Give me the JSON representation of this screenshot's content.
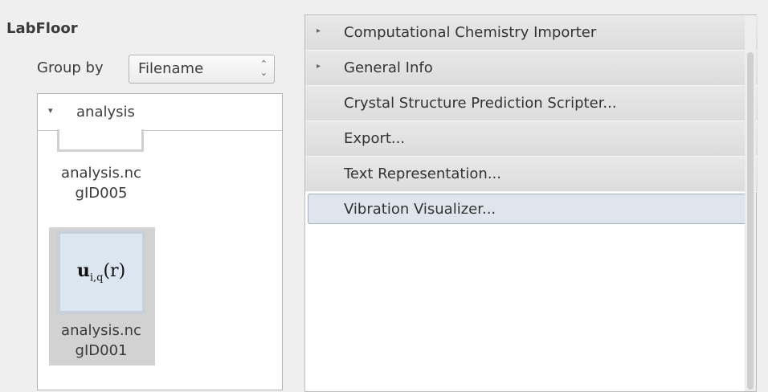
{
  "labfloor": {
    "title": "LabFloor",
    "group_by_label": "Group by",
    "group_by_value": "Filename",
    "group_by_arrows": "⌃⌄",
    "tree": {
      "toggle_glyph": "▾",
      "header": "analysis",
      "items": [
        {
          "line1": "analysis.nc",
          "line2": "gID005",
          "icon": "blank-thumbnail-icon"
        },
        {
          "line1": "analysis.nc",
          "line2": "gID001",
          "icon": "vibration-math-icon",
          "math_main": "u",
          "math_sub": "i,q",
          "math_arg": "(r)"
        }
      ]
    }
  },
  "tools": {
    "expand_glyph": "▸",
    "rows": [
      {
        "label": "Computational Chemistry Importer",
        "expandable": true
      },
      {
        "label": "General Info",
        "expandable": true
      },
      {
        "label": "Crystal Structure Prediction Scripter...",
        "expandable": false
      },
      {
        "label": "Export...",
        "expandable": false
      },
      {
        "label": "Text Representation...",
        "expandable": false
      },
      {
        "label": "Vibration Visualizer...",
        "expandable": false,
        "selected": true
      }
    ]
  }
}
